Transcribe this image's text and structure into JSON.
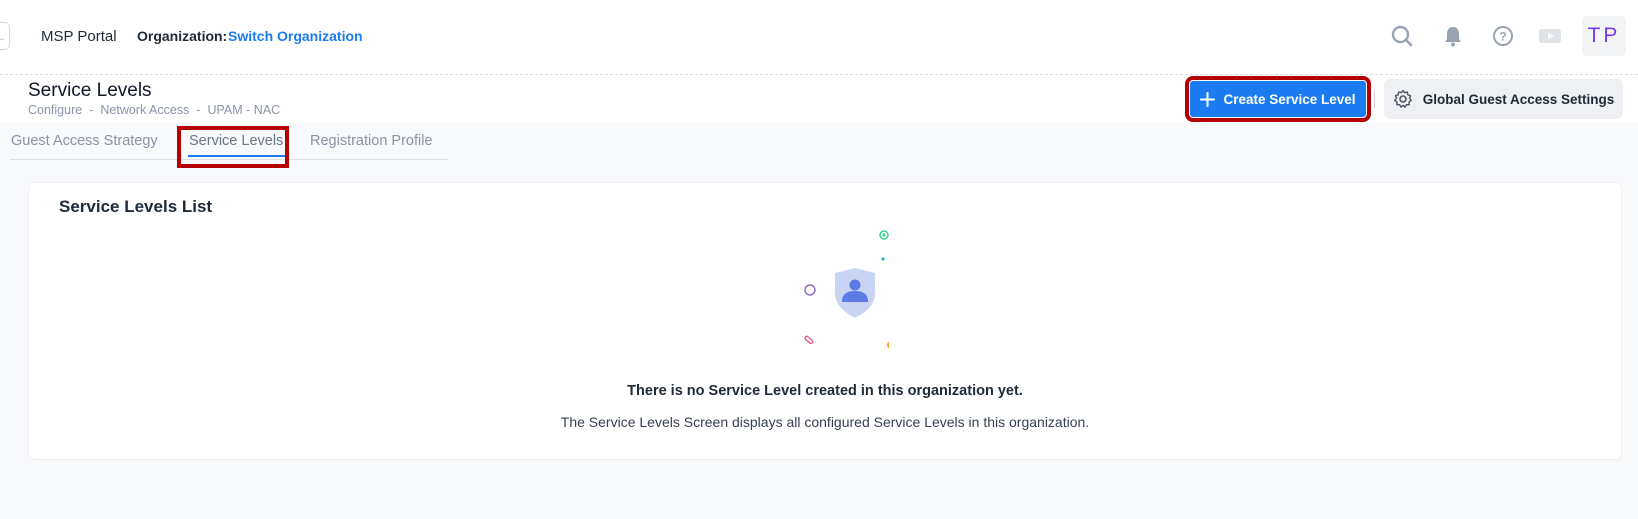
{
  "header": {
    "back_glyph": "←",
    "portal_title": "MSP Portal",
    "org_label": "Organization:",
    "org_switch": "Switch Organization",
    "avatar_initials": "TP",
    "icons": [
      "search-icon",
      "bell-icon",
      "help-icon",
      "video-icon"
    ]
  },
  "page": {
    "title": "Service Levels",
    "breadcrumb": [
      "Configure",
      "-",
      "Network Access",
      "-",
      "UPAM - NAC"
    ],
    "create_button": "Create Service Level",
    "create_icon": "plus-icon",
    "global_button": "Global Guest Access Settings",
    "global_icon": "gear-icon"
  },
  "tabs": [
    {
      "label": "Guest Access Strategy",
      "active": false
    },
    {
      "label": "Service Levels",
      "active": true
    },
    {
      "label": "Registration Profile",
      "active": false
    }
  ],
  "card": {
    "title": "Service Levels List",
    "empty_title": "There is no Service Level created in this organization yet.",
    "empty_description": "The Service Levels Screen displays all configured Service Levels in this organization.",
    "illustration_icon": "shield-user-icon"
  },
  "colors": {
    "accent": "#1a7cf0",
    "highlight_box": "#b40000",
    "avatar_text": "#7c3aed",
    "shield": "#c9d4f5",
    "person": "#5b7be6"
  }
}
